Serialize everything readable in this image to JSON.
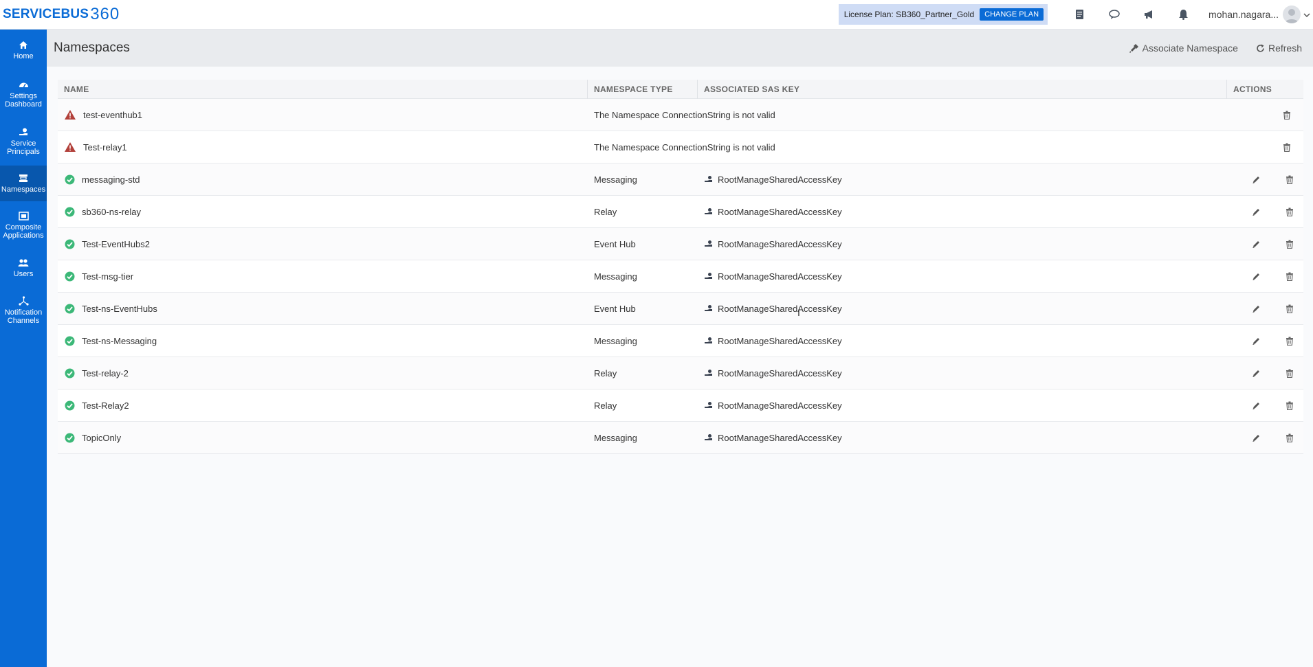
{
  "app": {
    "logo_text": "SERVICEBUS",
    "logo_num": "360"
  },
  "topbar": {
    "license_label": "License Plan: SB360_Partner_Gold",
    "change_plan_label": "CHANGE PLAN",
    "icons": [
      "docs-icon",
      "chat-icon",
      "announcement-icon",
      "bell-icon"
    ],
    "user_name": "mohan.nagara..."
  },
  "sidebar": {
    "items": [
      {
        "label": "Home",
        "icon": "home-icon"
      },
      {
        "label": "Settings Dashboard",
        "icon": "dashboard-icon"
      },
      {
        "label": "Service Principals",
        "icon": "service-principal-icon"
      },
      {
        "label": "Namespaces",
        "icon": "namespace-icon",
        "active": true
      },
      {
        "label": "Composite Applications",
        "icon": "composite-icon"
      },
      {
        "label": "Users",
        "icon": "users-icon"
      },
      {
        "label": "Notification Channels",
        "icon": "notification-icon"
      }
    ]
  },
  "page": {
    "title": "Namespaces",
    "associate_label": "Associate Namespace",
    "refresh_label": "Refresh"
  },
  "table": {
    "columns": [
      "NAME",
      "NAMESPACE TYPE",
      "ASSOCIATED SAS KEY",
      "ACTIONS"
    ],
    "rows": [
      {
        "name": "test-eventhub1",
        "status": "error",
        "error": "The Namespace ConnectionString is not valid"
      },
      {
        "name": "Test-relay1",
        "status": "error",
        "error": "The Namespace ConnectionString is not valid"
      },
      {
        "name": "messaging-std",
        "status": "ok",
        "type": "Messaging",
        "key": "RootManageSharedAccessKey"
      },
      {
        "name": "sb360-ns-relay",
        "status": "ok",
        "type": "Relay",
        "key": "RootManageSharedAccessKey"
      },
      {
        "name": "Test-EventHubs2",
        "status": "ok",
        "type": "Event Hub",
        "key": "RootManageSharedAccessKey"
      },
      {
        "name": "Test-msg-tier",
        "status": "ok",
        "type": "Messaging",
        "key": "RootManageSharedAccessKey"
      },
      {
        "name": "Test-ns-EventHubs",
        "status": "ok",
        "type": "Event Hub",
        "key": "RootManageSharedAccessKey"
      },
      {
        "name": "Test-ns-Messaging",
        "status": "ok",
        "type": "Messaging",
        "key": "RootManageSharedAccessKey"
      },
      {
        "name": "Test-relay-2",
        "status": "ok",
        "type": "Relay",
        "key": "RootManageSharedAccessKey"
      },
      {
        "name": "Test-Relay2",
        "status": "ok",
        "type": "Relay",
        "key": "RootManageSharedAccessKey"
      },
      {
        "name": "TopicOnly",
        "status": "ok",
        "type": "Messaging",
        "key": "RootManageSharedAccessKey"
      }
    ]
  },
  "colors": {
    "brand": "#0a6bd6",
    "ok": "#3cb878",
    "error": "#b2403a"
  }
}
